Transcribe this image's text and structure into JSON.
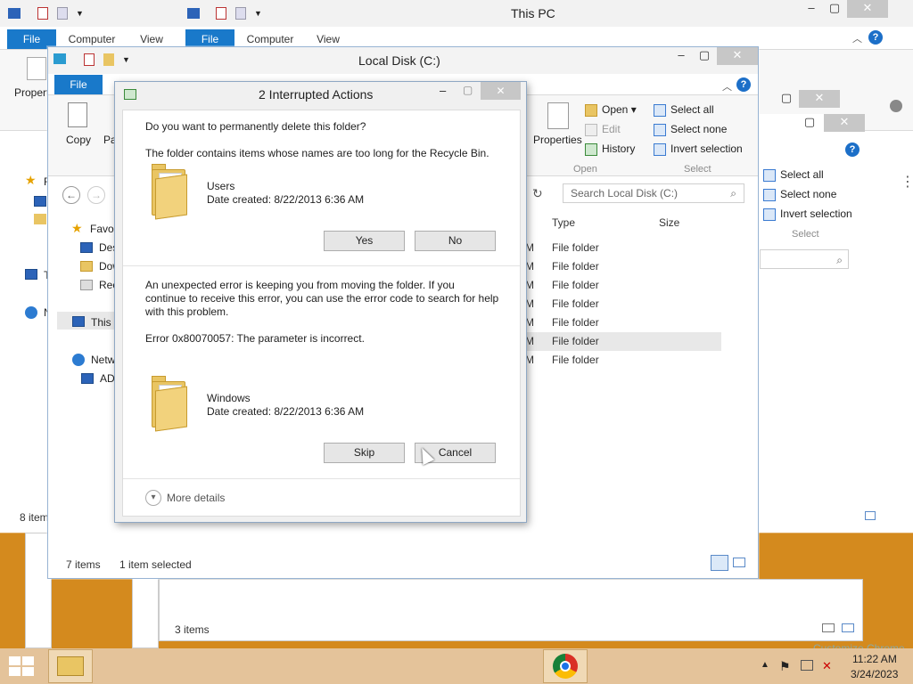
{
  "windows": {
    "back_window": {
      "title": "This PC",
      "tabs": [
        "File",
        "Computer",
        "View"
      ],
      "ribbon": {
        "properties_label": "Propert"
      },
      "select_group": {
        "select_all": "Select all",
        "select_none": "Select none",
        "invert_selection": "Invert selection",
        "group_label": "Select"
      },
      "status_items": "3 items",
      "partial_nav": [
        "F",
        "T",
        "N"
      ],
      "left_partial_status": "8 item"
    },
    "mid_window": {
      "tabs": [
        "File",
        "Computer",
        "View"
      ],
      "ribbon": {
        "properties_label": "Propert"
      }
    },
    "local_disk": {
      "title": "Local Disk (C:)",
      "tab_file": "File",
      "ribbon": {
        "copy": "Copy",
        "paste": "Pa",
        "properties": "Properties",
        "open": "Open",
        "edit": "Edit",
        "history": "History",
        "open_group": "Open",
        "select_all": "Select all",
        "select_none": "Select none",
        "invert_selection": "Invert selection",
        "select_group": "Select"
      },
      "search_placeholder": "Search Local Disk (C:)",
      "columns": {
        "type": "Type",
        "size": "Size"
      },
      "rows": [
        "File folder",
        "File folder",
        "File folder",
        "File folder",
        "File folder",
        "File folder",
        "File folder"
      ],
      "row_prefix": "M",
      "nav": {
        "favorites": "Favo",
        "desktop": "Des",
        "downloads": "Dow",
        "recent": "Rec",
        "this_pc": "This I",
        "network": "Netw",
        "ad": "AD"
      },
      "status": {
        "items": "7 items",
        "selected": "1 item selected"
      }
    }
  },
  "dialog": {
    "title": "2 Interrupted Actions",
    "question": "Do you want to permanently delete this folder?",
    "reason": "The folder contains items whose names are too long for the Recycle Bin.",
    "item1": {
      "name": "Users",
      "date": "Date created: 8/22/2013 6:36 AM"
    },
    "yes": "Yes",
    "no": "No",
    "error_text_1": "An unexpected error is keeping you from moving the folder. If you",
    "error_text_2": "continue to receive this error, you can use the error code to search for help",
    "error_text_3": "with this problem.",
    "error_code": "Error 0x80070057: The parameter is incorrect.",
    "item2": {
      "name": "Windows",
      "date": "Date created: 8/22/2013 6:36 AM"
    },
    "skip": "Skip",
    "cancel": "Cancel",
    "more_details": "More details"
  },
  "taskbar": {
    "time": "11:22 AM",
    "date": "3/24/2023",
    "customize": "Customize Chrome"
  },
  "colors": {
    "accent": "#1979ca",
    "desktop": "#d48a1e",
    "taskbar": "#e4c39a"
  }
}
